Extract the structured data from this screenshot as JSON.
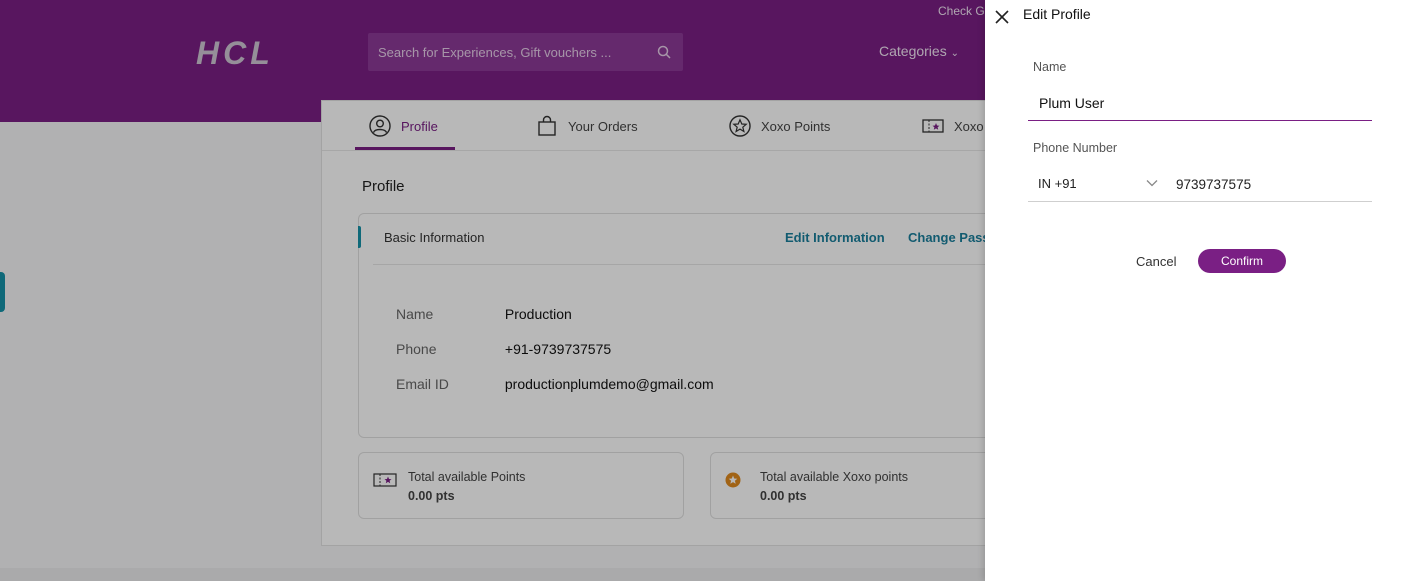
{
  "header": {
    "logo_text": "HCL",
    "search_placeholder": "Search for Experiences, Gift vouchers ...",
    "categories_label": "Categories",
    "check_label": "Check G"
  },
  "tabs": [
    {
      "label": "Profile",
      "icon": "user-circle-icon",
      "active": true
    },
    {
      "label": "Your Orders",
      "icon": "shopping-bag-icon",
      "active": false
    },
    {
      "label": "Xoxo Points",
      "icon": "star-circle-icon",
      "active": false
    },
    {
      "label": "Xoxo",
      "icon": "ticket-icon",
      "active": false
    }
  ],
  "profile": {
    "section_title": "Profile",
    "basic_info_label": "Basic Information",
    "edit_info_label": "Edit Information",
    "change_password_label": "Change Pass",
    "fields": [
      {
        "key": "Name",
        "value": "Production"
      },
      {
        "key": "Phone",
        "value": "+91-9739737575"
      },
      {
        "key": "Email ID",
        "value": "productionplumdemo@gmail.com"
      }
    ]
  },
  "points": [
    {
      "label": "Total available Points",
      "value": "0.00 pts",
      "icon": "ticket-icon"
    },
    {
      "label": "Total available Xoxo points",
      "value": "0.00 pts",
      "icon": "xoxo-coin-icon"
    }
  ],
  "drawer": {
    "title": "Edit Profile",
    "name_label": "Name",
    "name_value": "Plum User",
    "phone_label": "Phone Number",
    "country_code": "IN +91",
    "phone_value": "9739737575",
    "cancel_label": "Cancel",
    "confirm_label": "Confirm"
  },
  "colors": {
    "brand": "#7a1f84",
    "link": "#1a7f9c",
    "accent": "#1592a8"
  }
}
